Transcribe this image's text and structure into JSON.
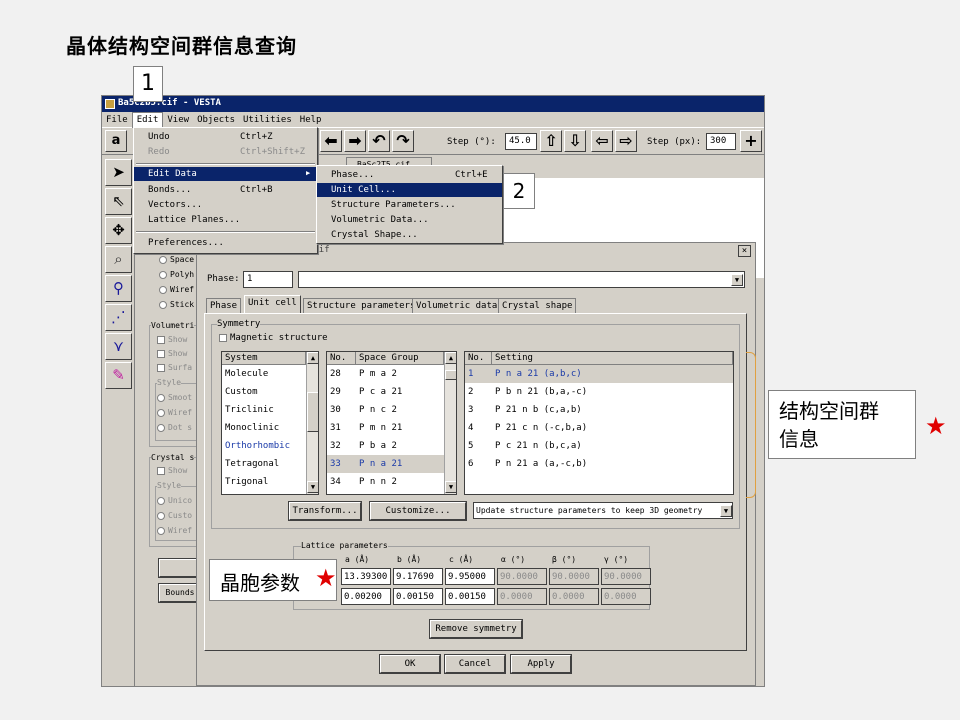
{
  "slide": {
    "title": "晶体结构空间群信息查询"
  },
  "annotations": {
    "step1": "1",
    "step2": "2",
    "space_group_info": "结构空间群\n信息",
    "space_group_info_l1": "结构空间群",
    "space_group_info_l2": "信息",
    "lattice_params": "晶胞参数",
    "star": "★",
    "star_color": "#e00000"
  },
  "window": {
    "title": "Ba5c2b5.cif - VESTA",
    "menubar": [
      "File",
      "Edit",
      "View",
      "Objects",
      "Utilities",
      "Help"
    ],
    "toolbar": {
      "mode_label": "a",
      "step_deg_label": "Step (°):",
      "step_deg_value": "45.0",
      "step_px_label": "Step (px):",
      "step_px_value": "300"
    },
    "file_tab": "BaSc2T5.cif",
    "left_tools": [
      "select-arrow",
      "select-pointer",
      "move-cross",
      "zoom",
      "bond-tool",
      "angle-tool",
      "dihedral-tool",
      "pen-tool"
    ]
  },
  "left_panel": {
    "style_options": [
      "Space",
      "Polyh",
      "Wiref",
      "Stick"
    ],
    "volumetric_label": "Volumetri",
    "volumetric_checks": [
      "Show",
      "Show",
      "Surfa"
    ],
    "style_label": "Style",
    "volumetric_styles": [
      "Smoot",
      "Wiref",
      "Dot s"
    ],
    "crystal_label": "Crystal s",
    "crystal_checks": [
      "Show"
    ],
    "crystal_styles": [
      "Unico",
      "Custo",
      "Wiref"
    ],
    "bounds_button": "Bounds"
  },
  "edit_menu": {
    "items": [
      {
        "label": "Undo",
        "shortcut": "Ctrl+Z"
      },
      {
        "label": "Redo",
        "shortcut": "Ctrl+Shift+Z"
      },
      {
        "label": "Edit Data",
        "shortcut": ""
      },
      {
        "label": "Bonds...",
        "shortcut": "Ctrl+B"
      },
      {
        "label": "Vectors...",
        "shortcut": ""
      },
      {
        "label": "Lattice Planes...",
        "shortcut": ""
      },
      {
        "label": "Preferences...",
        "shortcut": ""
      }
    ],
    "submenu_arrow": "▶"
  },
  "edit_data_submenu": {
    "items": [
      {
        "label": "Phase...",
        "shortcut": "Ctrl+E"
      },
      {
        "label": "Unit Cell...",
        "shortcut": ""
      },
      {
        "label": "Structure Parameters...",
        "shortcut": ""
      },
      {
        "label": "Volumetric Data...",
        "shortcut": ""
      },
      {
        "label": "Crystal Shape...",
        "shortcut": ""
      }
    ]
  },
  "dialog": {
    "title": "Edit Data - BaSc2T5.cif",
    "close": "×",
    "phase_label": "Phase:",
    "phase_value": "1",
    "tabs": [
      "Phase",
      "Unit cell",
      "Structure parameters",
      "Volumetric data",
      "Crystal shape"
    ],
    "symmetry_label": "Symmetry",
    "magnetic_label": "Magnetic structure",
    "system_header": "System",
    "systems": [
      "Molecule",
      "Custom",
      "Triclinic",
      "Monoclinic",
      "Orthorhombic",
      "Tetragonal",
      "Trigonal"
    ],
    "sg_headers": [
      "No.",
      "Space Group"
    ],
    "space_groups": [
      {
        "no": "28",
        "name": "P m a 2"
      },
      {
        "no": "29",
        "name": "P c a 21"
      },
      {
        "no": "30",
        "name": "P n c 2"
      },
      {
        "no": "31",
        "name": "P m n 21"
      },
      {
        "no": "32",
        "name": "P b a 2"
      },
      {
        "no": "33",
        "name": "P n a 21"
      },
      {
        "no": "34",
        "name": "P n n 2"
      }
    ],
    "setting_headers": [
      "No.",
      "Setting"
    ],
    "settings": [
      {
        "no": "1",
        "name": "P n a 21 (a,b,c)"
      },
      {
        "no": "2",
        "name": "P b n 21 (b,a,-c)"
      },
      {
        "no": "3",
        "name": "P 21 n b (c,a,b)"
      },
      {
        "no": "4",
        "name": "P 21 c n (-c,b,a)"
      },
      {
        "no": "5",
        "name": "P c 21 n (b,c,a)"
      },
      {
        "no": "6",
        "name": "P n 21 a (a,-c,b)"
      }
    ],
    "transform_button": "Transform...",
    "customize_button": "Customize...",
    "update_option": "Update structure parameters to keep 3D geometry",
    "lattice_label": "Lattice parameters",
    "lattice_headers": [
      "a (Å)",
      "b (Å)",
      "c (Å)",
      "α (°)",
      "β (°)",
      "γ (°)"
    ],
    "lattice_values": [
      "13.39300",
      "9.17690",
      "9.95000",
      "90.0000",
      "90.0000",
      "90.0000"
    ],
    "lattice_errors": [
      "0.00200",
      "0.00150",
      "0.00150",
      "0.0000",
      "0.0000",
      "0.0000"
    ],
    "remove_symmetry": "Remove symmetry",
    "ok": "OK",
    "cancel": "Cancel",
    "apply": "Apply"
  }
}
